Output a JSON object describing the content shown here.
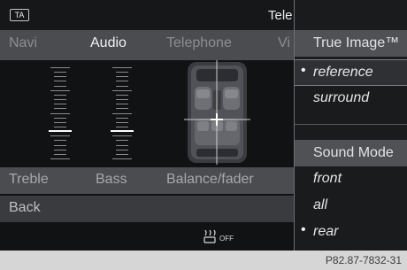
{
  "status_bar": {
    "badge": "TA",
    "source": "Tele"
  },
  "menu": {
    "items": [
      {
        "label": "Navi",
        "active": false
      },
      {
        "label": "Audio",
        "active": true
      },
      {
        "label": "Telephone",
        "active": false
      },
      {
        "label": "Vi",
        "active": false
      }
    ]
  },
  "equalizer": {
    "treble": {
      "level": 0.3
    },
    "bass": {
      "level": 0.3
    }
  },
  "controls": {
    "treble_label": "Treble",
    "bass_label": "Bass",
    "balance_label": "Balance/fader",
    "back_label": "Back"
  },
  "heat_indicator": {
    "icon": "seat-heat-icon",
    "label": "OFF"
  },
  "options_panel": {
    "true_image_header": "True Image™",
    "true_image_options": [
      {
        "label": "reference",
        "selected": true
      },
      {
        "label": "surround",
        "selected": false
      }
    ],
    "sound_mode_header": "Sound Mode",
    "sound_mode_options": [
      {
        "label": "front",
        "selected": false
      },
      {
        "label": "all",
        "selected": false
      },
      {
        "label": "rear",
        "selected": true
      }
    ],
    "bullet": "•"
  },
  "figure_ref": "P82.87-7832-31",
  "colors": {
    "background": "#111214",
    "menu_bar": "#4a4c50",
    "panel": "#1a1b1d",
    "highlight": "#2f3034"
  }
}
